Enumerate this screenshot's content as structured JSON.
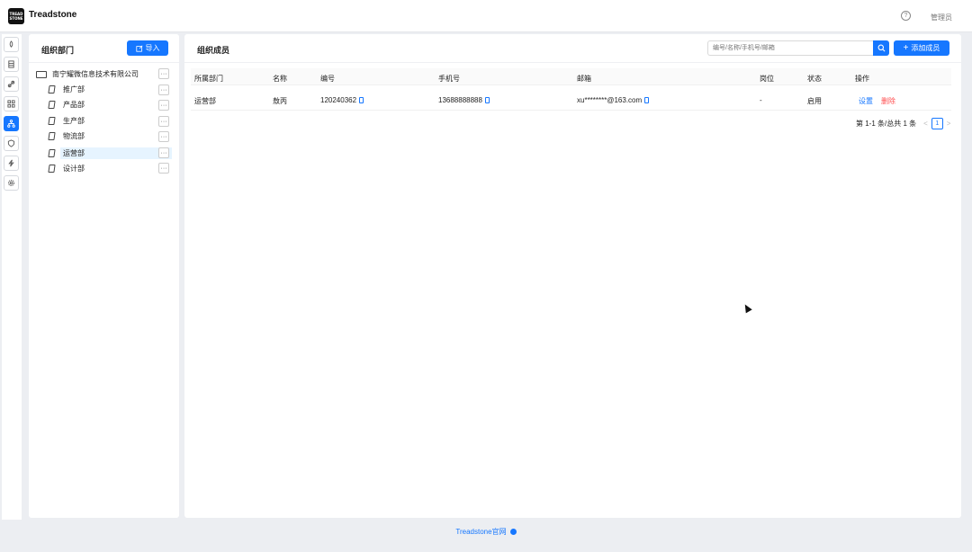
{
  "app": {
    "title": "Treadstone",
    "logo_text": "TREAD STONE",
    "user": "管理员"
  },
  "rail": {
    "items": [
      "rocket-icon",
      "database-icon",
      "link-icon",
      "grid-icon",
      "org-icon",
      "shield-icon",
      "bolt-icon",
      "gear-icon"
    ],
    "active": "org-icon"
  },
  "left_panel": {
    "title": "组织部门",
    "import_label": "导入",
    "root": "南宁耀微信息技术有限公司",
    "departments": [
      "推广部",
      "产品部",
      "生产部",
      "物流部",
      "运营部",
      "设计部"
    ],
    "selected": "运营部",
    "more_label": "···"
  },
  "right_panel": {
    "title": "组织成员",
    "search_placeholder": "编号/名称/手机号/邮箱",
    "add_label": "添加成员",
    "columns": [
      "所属部门",
      "名称",
      "编号",
      "手机号",
      "邮箱",
      "岗位",
      "状态",
      "操作"
    ],
    "rows": [
      {
        "dept": "运营部",
        "name": "敖丙",
        "code": "120240362",
        "phone": "13688888888",
        "email": "xu********@163.com",
        "position": "-",
        "status": "启用",
        "action_edit": "设置",
        "action_delete": "删除"
      }
    ],
    "pagination": {
      "summary": "第 1-1 条/总共 1 条",
      "current_page": "1",
      "prev": "<",
      "next": ">"
    }
  },
  "footer": {
    "link": "Treadstone官网"
  },
  "colors": {
    "primary": "#1677ff",
    "danger": "#ff4d4f",
    "selected_bg": "#e6f4ff"
  }
}
